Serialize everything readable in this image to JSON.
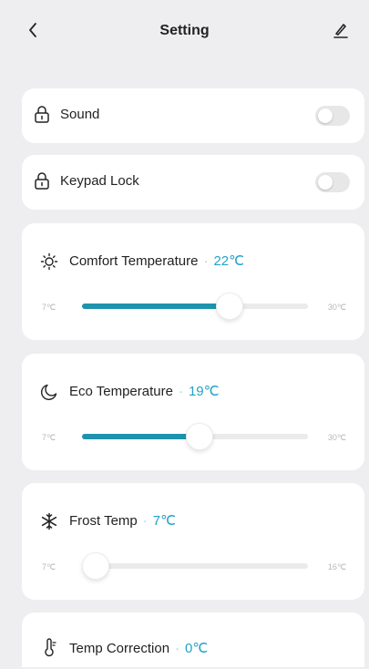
{
  "header": {
    "title": "Setting",
    "back_icon": "chevron-left-icon",
    "edit_icon": "pencil-icon"
  },
  "accent_color": "#1f93ad",
  "value_color": "#23a3c6",
  "toggles": [
    {
      "label": "Sound",
      "on": false,
      "icon": "lock-icon"
    },
    {
      "label": "Keypad Lock",
      "on": false,
      "icon": "lock-icon"
    }
  ],
  "sliders": [
    {
      "label": "Comfort Temperature",
      "value": "22℃",
      "min_label": "7℃",
      "max_label": "30℃",
      "level": 22,
      "min": 7,
      "max": 30,
      "icon": "sun-icon"
    },
    {
      "label": "Eco Temperature",
      "value": "19℃",
      "min_label": "7℃",
      "max_label": "30℃",
      "level": 19,
      "min": 7,
      "max": 30,
      "icon": "moon-icon"
    },
    {
      "label": "Frost Temp",
      "value": "7℃",
      "min_label": "7℃",
      "max_label": "16℃",
      "level": 7,
      "min": 7,
      "max": 16,
      "icon": "snowflake-icon"
    }
  ],
  "correction": {
    "label": "Temp Correction",
    "value": "0℃",
    "icon": "thermometer-icon"
  }
}
